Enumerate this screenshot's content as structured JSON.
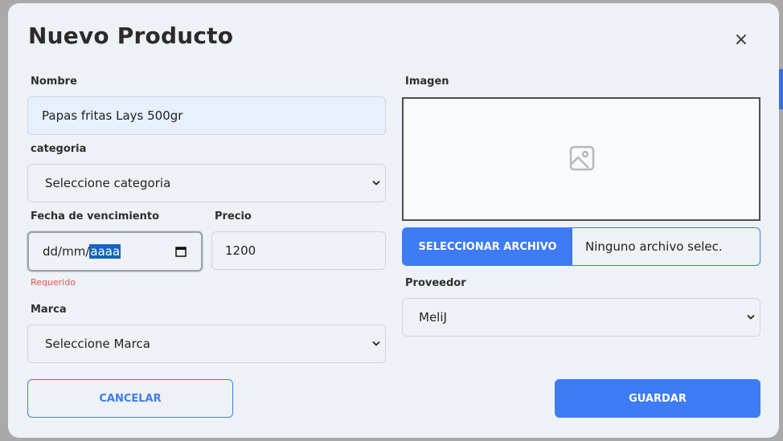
{
  "modal": {
    "title": "Nuevo Producto",
    "close_glyph": "×"
  },
  "form": {
    "nombre": {
      "label": "Nombre",
      "value": "Papas fritas Lays 500gr"
    },
    "categoria": {
      "label": "categoria",
      "value": "Seleccione categoria"
    },
    "fecha": {
      "label": "Fecha de vencimiento",
      "placeholder_dd": "dd",
      "placeholder_mm": "mm",
      "placeholder_year": "aaaa",
      "error": "Requerido"
    },
    "precio": {
      "label": "Precio",
      "value": "1200"
    },
    "marca": {
      "label": "Marca",
      "value": "Seleccione Marca"
    },
    "imagen": {
      "label": "Imagen",
      "placeholder_icon": "image-placeholder-icon"
    },
    "archivo": {
      "button_label": "SELECCIONAR ARCHIVO",
      "status": "Ninguno archivo selec."
    },
    "proveedor": {
      "label": "Proveedor",
      "value": "MeliJ"
    }
  },
  "actions": {
    "cancel_label": "CANCELAR",
    "save_label": "GUARDAR"
  },
  "colors": {
    "primary": "#3d7bf7",
    "error": "#e0554f",
    "modal_bg": "#eef2f6",
    "filled_input_bg": "#e8f0fe"
  }
}
